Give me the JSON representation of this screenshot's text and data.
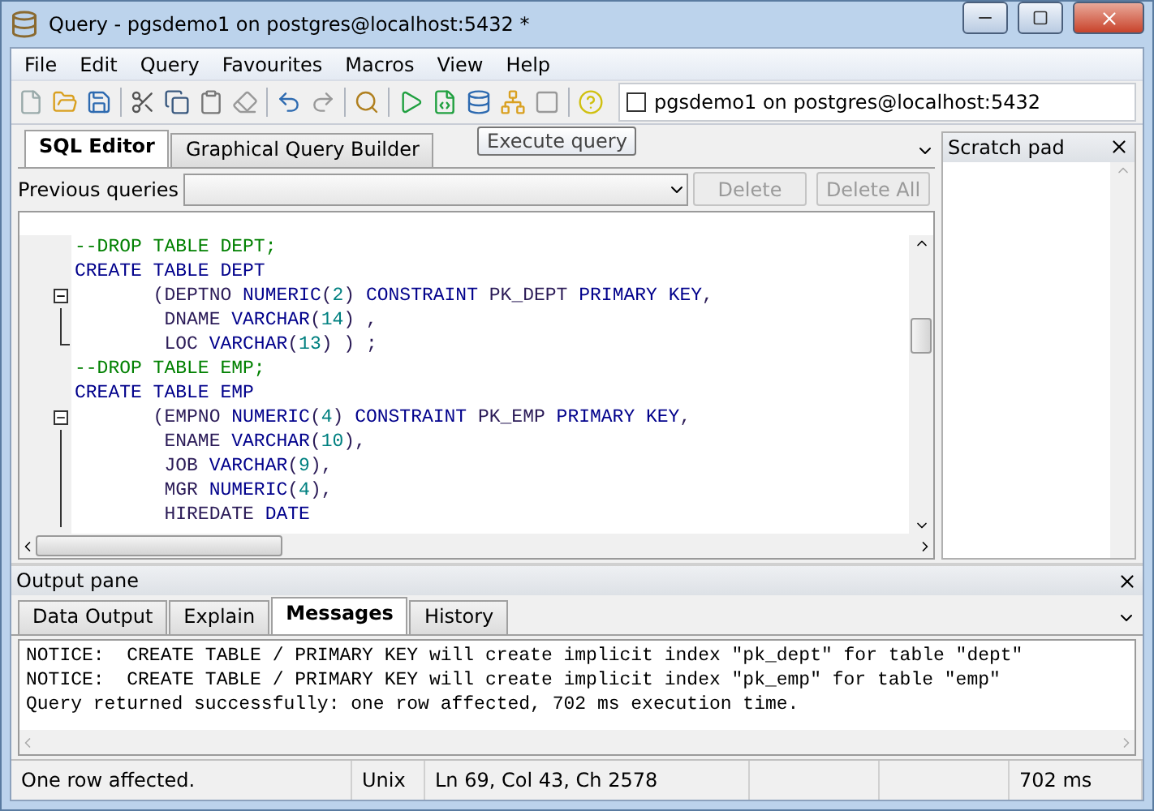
{
  "window": {
    "title": "Query - pgsdemo1 on postgres@localhost:5432 *"
  },
  "menu": [
    "File",
    "Edit",
    "Query",
    "Favourites",
    "Macros",
    "View",
    "Help"
  ],
  "connection": {
    "checked": false,
    "label": "pgsdemo1 on postgres@localhost:5432"
  },
  "tooltip": "Execute query",
  "editor_tabs": [
    {
      "label": "SQL Editor",
      "selected": true
    },
    {
      "label": "Graphical Query Builder",
      "selected": false
    }
  ],
  "previous_queries": {
    "label": "Previous queries",
    "buttons": [
      {
        "label": "Delete",
        "disabled": true
      },
      {
        "label": "Delete All",
        "disabled": true
      }
    ]
  },
  "code": [
    {
      "kind": "plain",
      "tokens": [
        {
          "t": "--DROP TABLE DEPT;",
          "kind": "comment"
        }
      ]
    },
    {
      "kind": "plain",
      "tokens": [
        {
          "t": "CREATE TABLE DEPT",
          "kind": "keyword"
        }
      ]
    },
    {
      "kind": "fold_start",
      "tokens": [
        {
          "t": "       (DEPTNO ",
          "kind": "name"
        },
        {
          "t": "NUMERIC",
          "kind": "keyword"
        },
        {
          "t": "(",
          "kind": "name"
        },
        {
          "t": "2",
          "kind": "number"
        },
        {
          "t": ") ",
          "kind": "name"
        },
        {
          "t": "CONSTRAINT",
          "kind": "keyword"
        },
        {
          "t": " PK_DEPT ",
          "kind": "name"
        },
        {
          "t": "PRIMARY KEY",
          "kind": "keyword"
        },
        {
          "t": ",",
          "kind": "name"
        }
      ]
    },
    {
      "kind": "fold_line",
      "tokens": [
        {
          "t": "        DNAME ",
          "kind": "name"
        },
        {
          "t": "VARCHAR",
          "kind": "keyword"
        },
        {
          "t": "(",
          "kind": "name"
        },
        {
          "t": "14",
          "kind": "number"
        },
        {
          "t": ") ,",
          "kind": "name"
        }
      ]
    },
    {
      "kind": "fold_end",
      "tokens": [
        {
          "t": "        LOC ",
          "kind": "name"
        },
        {
          "t": "VARCHAR",
          "kind": "keyword"
        },
        {
          "t": "(",
          "kind": "name"
        },
        {
          "t": "13",
          "kind": "number"
        },
        {
          "t": ") ) ;",
          "kind": "name"
        }
      ]
    },
    {
      "kind": "plain",
      "tokens": [
        {
          "t": "--DROP TABLE EMP;",
          "kind": "comment"
        }
      ]
    },
    {
      "kind": "plain",
      "tokens": [
        {
          "t": "CREATE TABLE EMP",
          "kind": "keyword"
        }
      ]
    },
    {
      "kind": "fold_start",
      "tokens": [
        {
          "t": "       (EMPNO ",
          "kind": "name"
        },
        {
          "t": "NUMERIC",
          "kind": "keyword"
        },
        {
          "t": "(",
          "kind": "name"
        },
        {
          "t": "4",
          "kind": "number"
        },
        {
          "t": ") ",
          "kind": "name"
        },
        {
          "t": "CONSTRAINT",
          "kind": "keyword"
        },
        {
          "t": " PK_EMP ",
          "kind": "name"
        },
        {
          "t": "PRIMARY KEY",
          "kind": "keyword"
        },
        {
          "t": ",",
          "kind": "name"
        }
      ]
    },
    {
      "kind": "fold_line",
      "tokens": [
        {
          "t": "        ENAME ",
          "kind": "name"
        },
        {
          "t": "VARCHAR",
          "kind": "keyword"
        },
        {
          "t": "(",
          "kind": "name"
        },
        {
          "t": "10",
          "kind": "number"
        },
        {
          "t": "),",
          "kind": "name"
        }
      ]
    },
    {
      "kind": "fold_line",
      "tokens": [
        {
          "t": "        JOB ",
          "kind": "name"
        },
        {
          "t": "VARCHAR",
          "kind": "keyword"
        },
        {
          "t": "(",
          "kind": "name"
        },
        {
          "t": "9",
          "kind": "number"
        },
        {
          "t": "),",
          "kind": "name"
        }
      ]
    },
    {
      "kind": "fold_line",
      "tokens": [
        {
          "t": "        MGR ",
          "kind": "name"
        },
        {
          "t": "NUMERIC",
          "kind": "keyword"
        },
        {
          "t": "(",
          "kind": "name"
        },
        {
          "t": "4",
          "kind": "number"
        },
        {
          "t": "),",
          "kind": "name"
        }
      ]
    },
    {
      "kind": "fold_line",
      "tokens": [
        {
          "t": "        HIREDATE ",
          "kind": "name"
        },
        {
          "t": "DATE",
          "kind": "keyword"
        }
      ]
    }
  ],
  "scratch_pad": {
    "title": "Scratch pad"
  },
  "output_pane": {
    "title": "Output pane",
    "tabs": [
      {
        "label": "Data Output",
        "selected": false
      },
      {
        "label": "Explain",
        "selected": false
      },
      {
        "label": "Messages",
        "selected": true
      },
      {
        "label": "History",
        "selected": false
      }
    ],
    "messages": [
      "NOTICE:  CREATE TABLE / PRIMARY KEY will create implicit index \"pk_dept\" for table \"dept\"",
      "NOTICE:  CREATE TABLE / PRIMARY KEY will create implicit index \"pk_emp\" for table \"emp\"",
      "Query returned successfully: one row affected, 702 ms execution time."
    ]
  },
  "status_bar": {
    "message": "One row affected.",
    "line_endings": "Unix",
    "position": "Ln 69, Col 43, Ch 2578",
    "duration": "702 ms"
  }
}
